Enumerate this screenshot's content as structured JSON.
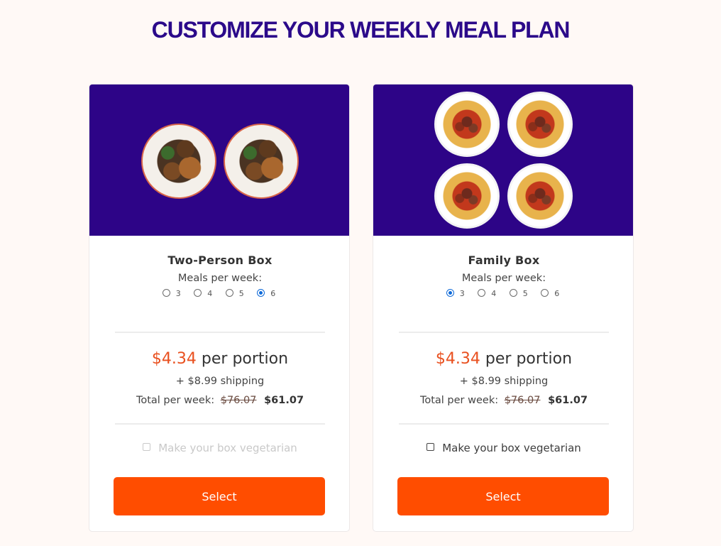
{
  "page": {
    "title": "CUSTOMIZE YOUR WEEKLY MEAL PLAN"
  },
  "colors": {
    "brand_purple": "#2d0487",
    "accent_orange": "#ff4d00",
    "price_orange": "#e9501f",
    "background": "#fff9f6"
  },
  "plans": [
    {
      "name": "Two-Person Box",
      "image": "chicken-dish-plates-icon",
      "meals_label": "Meals per week:",
      "meal_options": [
        "3",
        "4",
        "5",
        "6"
      ],
      "selected_meals": "6",
      "price": "$4.34",
      "price_suffix": "per portion",
      "shipping": "+ $8.99 shipping",
      "total_label": "Total per week:",
      "total_old": "$76.07",
      "total_new": "$61.07",
      "vegetarian_label": "Make your box vegetarian",
      "vegetarian_enabled": false,
      "select_label": "Select"
    },
    {
      "name": "Family Box",
      "image": "pasta-dish-plates-icon",
      "meals_label": "Meals per week:",
      "meal_options": [
        "3",
        "4",
        "5",
        "6"
      ],
      "selected_meals": "3",
      "price": "$4.34",
      "price_suffix": "per portion",
      "shipping": "+ $8.99 shipping",
      "total_label": "Total per week:",
      "total_old": "$76.07",
      "total_new": "$61.07",
      "vegetarian_label": "Make your box vegetarian",
      "vegetarian_enabled": true,
      "select_label": "Select"
    }
  ]
}
